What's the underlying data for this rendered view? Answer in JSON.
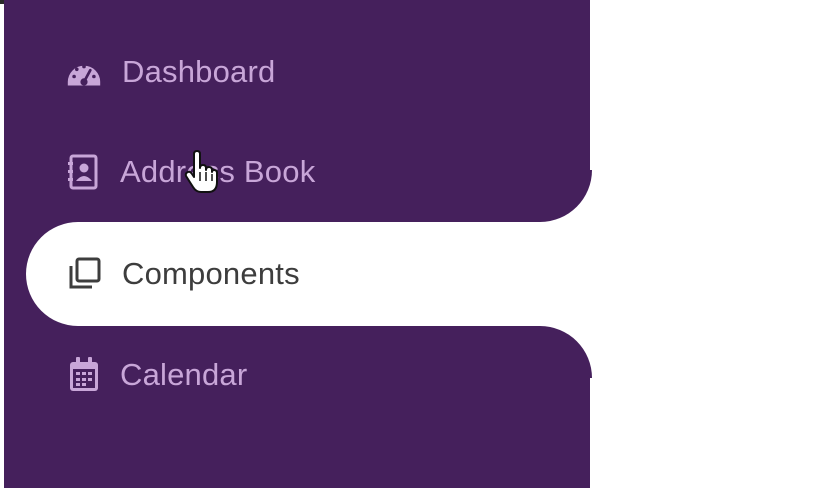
{
  "nav": {
    "items": [
      {
        "label": "Dashboard",
        "icon": "dashboard-gauge-icon",
        "active": false
      },
      {
        "label": "Address Book",
        "icon": "contact-book-icon",
        "active": false
      },
      {
        "label": "Components",
        "icon": "layers-copy-icon",
        "active": true
      },
      {
        "label": "Calendar",
        "icon": "calendar-icon",
        "active": false
      }
    ]
  },
  "colors": {
    "sidebar_bg": "#45205c",
    "item_text": "#c8a6d8",
    "active_text": "#3d3d3d",
    "active_bg": "#ffffff"
  }
}
